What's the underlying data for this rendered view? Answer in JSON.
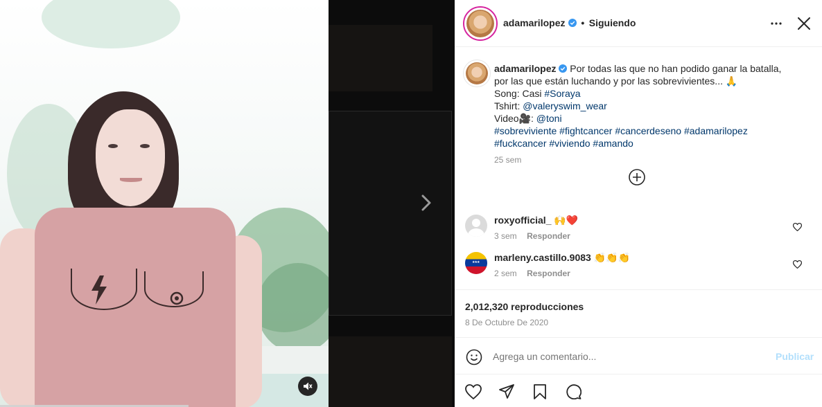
{
  "header": {
    "username": "adamarilopez",
    "separator": "•",
    "follow_status": "Siguiendo"
  },
  "caption": {
    "username": "adamarilopez",
    "lines": [
      "Por todas las que no han podido ganar la batalla,",
      "por las que están luchando y por las sobrevivientes... 🙏"
    ],
    "song_label": "Song: Casi ",
    "song_tag": "#Soraya",
    "tshirt_label": "Tshirt: ",
    "tshirt_tag": "@valeryswim_wear",
    "video_label": "Video🎥: ",
    "video_tag": "@toni",
    "hashtags_line1": [
      "#sobreviviente",
      "#fightcancer",
      "#cancerdeseno",
      "#adamarilopez"
    ],
    "hashtags_line2": [
      "#fuckcancer",
      "#viviendo",
      "#amando"
    ],
    "time": "25 sem"
  },
  "comments": [
    {
      "username": "roxyofficial_",
      "text": "🙌❤️",
      "time": "3 sem",
      "reply": "Responder",
      "avatar": "default-avatar"
    },
    {
      "username": "marleny.castillo.9083",
      "text": "👏👏👏",
      "time": "2 sem",
      "reply": "Responder",
      "avatar": "venezuela-flag-avatar"
    }
  ],
  "stats": {
    "views": "2,012,320 reproducciones",
    "date": "8 De Octubre De 2020"
  },
  "comment_box": {
    "placeholder": "Agrega un comentario...",
    "publish": "Publicar"
  },
  "icons": {
    "more": "more-options-icon",
    "close": "close-icon",
    "load_more": "plus-circle-icon",
    "like": "heart-icon",
    "share": "paper-plane-icon",
    "save": "bookmark-icon",
    "comment": "speech-bubble-icon",
    "emoji": "smiley-icon",
    "mute": "speaker-muted-icon",
    "next": "chevron-right-icon"
  },
  "colors": {
    "link": "#00376b",
    "publish_disabled": "#b2dffc",
    "verified": "#3897f0"
  }
}
